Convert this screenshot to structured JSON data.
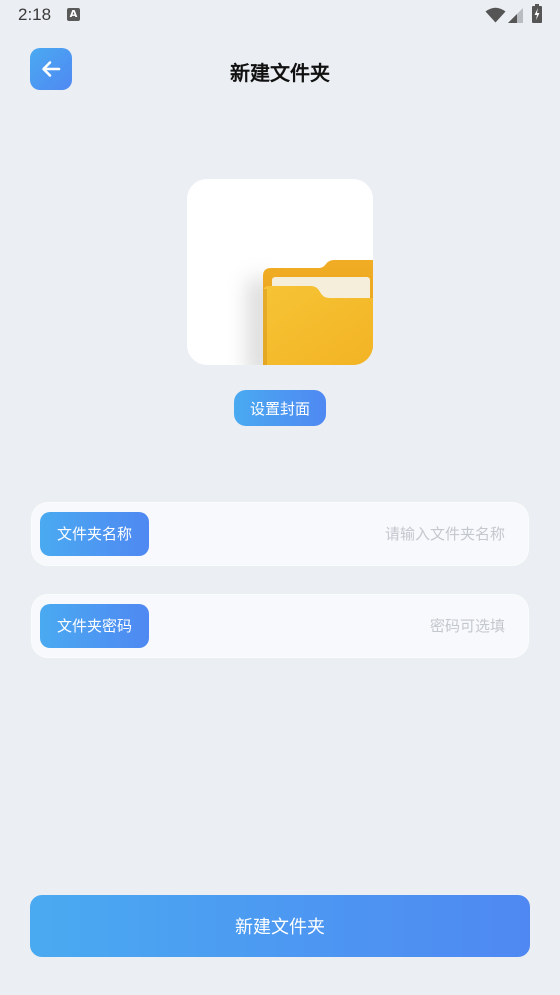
{
  "status_bar": {
    "time": "2:18",
    "notification_glyph": "A",
    "icons": [
      "a-notification-icon",
      "wifi-icon",
      "signal-icon",
      "battery-icon"
    ]
  },
  "header": {
    "back_icon": "arrow-left-icon",
    "title": "新建文件夹"
  },
  "cover": {
    "image": "folder-icon",
    "set_cover_label": "设置封面"
  },
  "form": {
    "name": {
      "label": "文件夹名称",
      "placeholder": "请输入文件夹名称",
      "value": ""
    },
    "password": {
      "label": "文件夹密码",
      "placeholder": "密码可选填",
      "value": ""
    }
  },
  "submit_label": "新建文件夹",
  "colors": {
    "background": "#ebeef2",
    "accent_start": "#4aaaf1",
    "accent_end": "#4f88f2",
    "placeholder": "#c3c7ce",
    "folder_front": "#f5bb2a",
    "folder_back": "#eda51f"
  }
}
